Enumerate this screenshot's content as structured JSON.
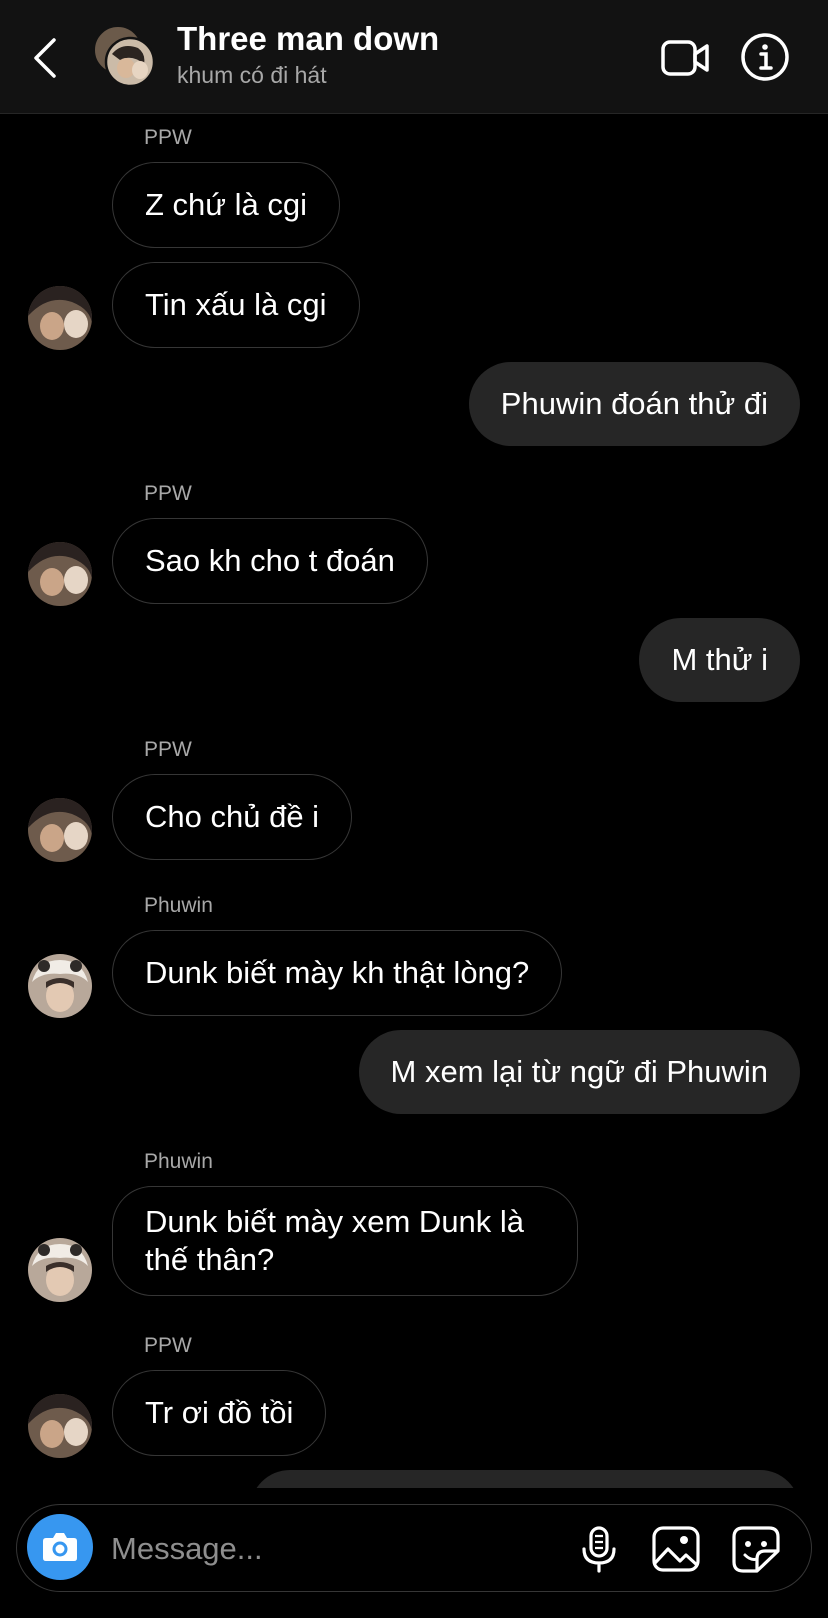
{
  "header": {
    "title": "Three man down",
    "subtitle": "khum có đi hát"
  },
  "messages": [
    {
      "direction": "in",
      "sender": "PPW",
      "text": "Z chứ là cgi"
    },
    {
      "direction": "in",
      "sender": "",
      "text": "Tin xấu là cgi",
      "avatar": "ppw"
    },
    {
      "direction": "out",
      "text": "Phuwin đoán thử đi"
    },
    {
      "direction": "in",
      "sender": "PPW",
      "text": "Sao kh cho t đoán",
      "avatar": "ppw"
    },
    {
      "direction": "out",
      "text": "M thử i"
    },
    {
      "direction": "in",
      "sender": "PPW",
      "text": "Cho chủ đề i",
      "avatar": "ppw"
    },
    {
      "direction": "in",
      "sender": "Phuwin",
      "text": "Dunk biết mày kh thật lòng?",
      "avatar": "phuwin"
    },
    {
      "direction": "out",
      "text": "M xem lại từ ngữ đi Phuwin"
    },
    {
      "direction": "in",
      "sender": "Phuwin",
      "text": "Dunk biết mày xem Dunk là thế thân?",
      "avatar": "phuwin"
    },
    {
      "direction": "in",
      "sender": "PPW",
      "text": "Tr ơi đồ tồi",
      "avatar": "ppw"
    }
  ],
  "composer": {
    "placeholder": "Message..."
  },
  "colors": {
    "background": "#000000",
    "header": "#121212",
    "outgoing_bubble": "#262626",
    "incoming_border": "#363636",
    "camera_button": "#3797f0",
    "secondary_text": "#a8a8a8"
  },
  "icons": [
    "back-chevron-icon",
    "video-call-icon",
    "info-icon",
    "camera-icon",
    "microphone-icon",
    "gallery-icon",
    "sticker-icon"
  ]
}
